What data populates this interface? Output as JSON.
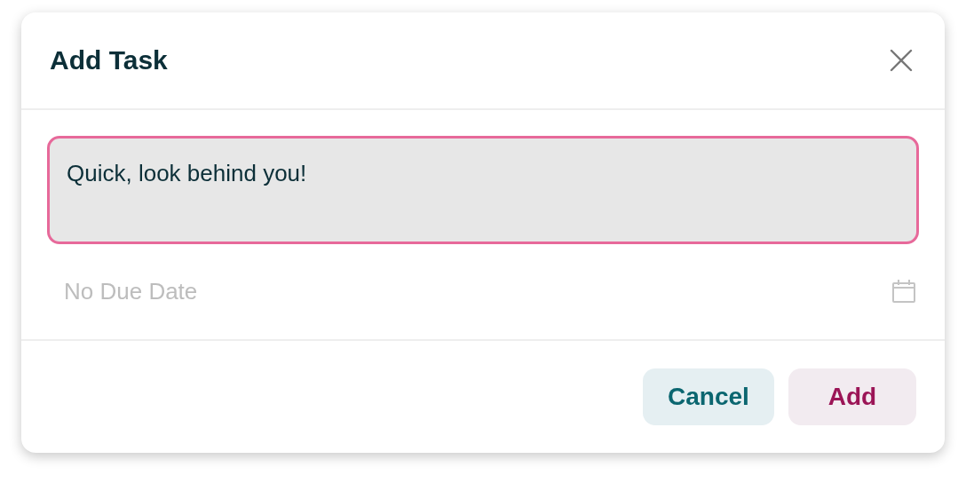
{
  "dialog": {
    "title": "Add Task"
  },
  "task_field": {
    "value": "Quick, look behind you!",
    "focused": true
  },
  "due_date": {
    "placeholder": "No Due Date"
  },
  "buttons": [
    {
      "label": "Cancel",
      "kind": "secondary"
    },
    {
      "label": "Add",
      "kind": "primary"
    }
  ]
}
